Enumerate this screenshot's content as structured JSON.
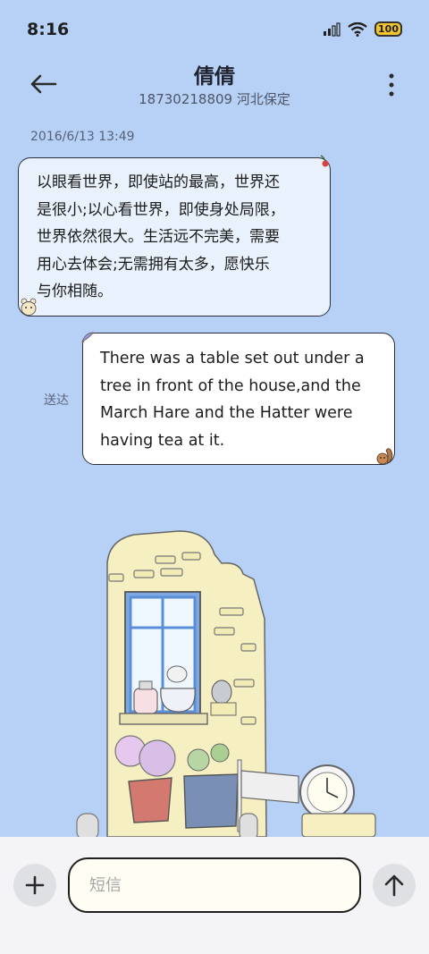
{
  "status_bar": {
    "time": "8:16",
    "battery": "100"
  },
  "header": {
    "name": "倩倩",
    "subtitle": "18730218809 河北保定"
  },
  "conversation": {
    "timestamp": "2016/6/13 13:49",
    "incoming": {
      "lines": [
        "以眼看世界，即使站的最高，世界还",
        "是很小;以心看世界，即使身处局限，",
        "世界依然很大。生活远不完美，需要",
        "用心去体会;无需拥有太多，愿快乐",
        "与你相随。"
      ]
    },
    "outgoing": {
      "lines": [
        "There was a table set out under a",
        "tree in front of the house,and the",
        "March Hare and the Hatter were",
        "having tea at it."
      ],
      "status": "送达"
    }
  },
  "composer": {
    "placeholder": "短信"
  },
  "icons": {
    "back": "arrow-left-icon",
    "more": "more-vertical-icon",
    "add": "plus-icon",
    "send": "arrow-up-icon",
    "signal": "signal-icon",
    "wifi": "wifi-icon",
    "battery": "battery-icon"
  },
  "colors": {
    "background": "#b7d1f6",
    "incoming_bubble": "#e8f1fc",
    "outgoing_bubble": "#ffffff",
    "battery": "#f2c431"
  }
}
